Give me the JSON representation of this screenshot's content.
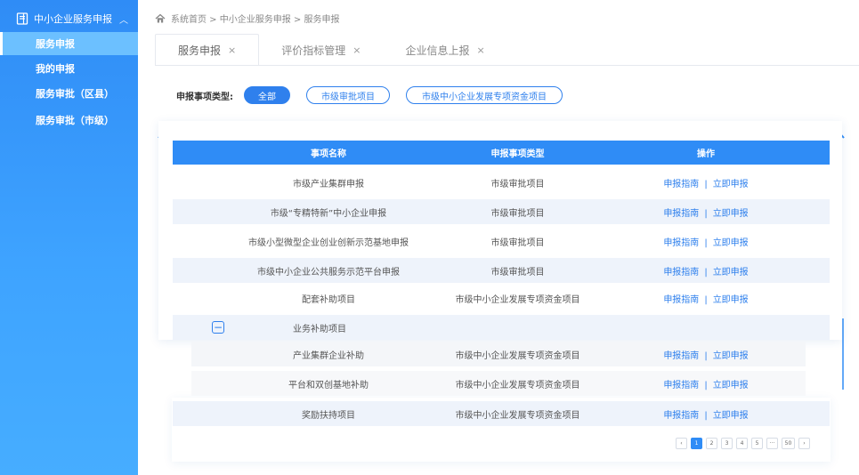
{
  "sidebar": {
    "group_label": "中小企业服务申报",
    "group_icon": "document-icon",
    "collapse_icon": "chevron-up-icon",
    "items": [
      {
        "label": "服务申报"
      },
      {
        "label": "我的申报"
      },
      {
        "label": "服务审批（区县）"
      },
      {
        "label": "服务审批（市级）"
      }
    ]
  },
  "breadcrumb": {
    "icon": "home-icon",
    "text": "系统首页 > 中小企业服务申报 > 服务申报"
  },
  "tabs": [
    {
      "label": "服务申报",
      "close": "×"
    },
    {
      "label": "评价指标管理",
      "close": "×"
    },
    {
      "label": "企业信息上报",
      "close": "×"
    }
  ],
  "filter": {
    "label": "申报事项类型:",
    "options": [
      "全部",
      "市级审批项目",
      "市级中小企业发展专项资金项目"
    ],
    "selected": "全部"
  },
  "table": {
    "headers": [
      "事项名称",
      "申报事项类型",
      "操作"
    ],
    "action_guide": "申报指南",
    "action_separator": "|",
    "action_apply": "立即申报",
    "rows": [
      {
        "name": "市级产业集群申报",
        "type": "市级审批项目"
      },
      {
        "name": "市级“专精特新”中小企业申报",
        "type": "市级审批项目"
      },
      {
        "name": "市级小型微型企业创业创新示范基地申报",
        "type": "市级审批项目"
      },
      {
        "name": "市级中小企业公共服务示范平台申报",
        "type": "市级审批项目"
      },
      {
        "name": "配套补助项目",
        "type": "市级中小企业发展专项资金项目"
      },
      {
        "name": "业务补助项目",
        "type": "",
        "collapse_icon": "minus-square-icon"
      },
      {
        "name": "产业集群企业补助",
        "type": "市级中小企业发展专项资金项目"
      },
      {
        "name": "平台和双创基地补助",
        "type": "市级中小企业发展专项资金项目"
      },
      {
        "name": "奖励扶持项目",
        "type": "市级中小企业发展专项资金项目"
      }
    ]
  },
  "pagination": {
    "prev": "‹",
    "pages": [
      "1",
      "2",
      "3",
      "4",
      "5",
      "···",
      "50"
    ],
    "current": "1",
    "next": "›"
  },
  "colors": {
    "accent": "#2f80ed",
    "header_bg": "#2f8cf6",
    "row_alt": "#eef3fb"
  }
}
